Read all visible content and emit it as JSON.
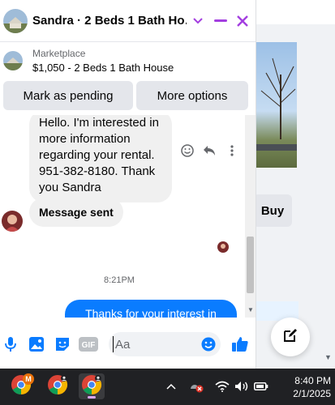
{
  "chat": {
    "title": "Sandra · 2 Beds 1 Bath Ho…",
    "marketplace_label": "Marketplace",
    "listing": "$1,050 - 2 Beds 1 Bath House",
    "mark_pending_label": "Mark as pending",
    "more_options_label": "More options"
  },
  "messages": {
    "incoming_text": "Hello. I'm interested in more information regarding your rental. 951-382-8180. Thank you Sandra",
    "sent_notice": "Message sent",
    "timestamp": "8:21PM",
    "outgoing_text": "Thanks for your interest in"
  },
  "composer": {
    "gif_label": "GIF",
    "placeholder": "Aa"
  },
  "background": {
    "buy_label": "Buy"
  },
  "taskbar": {
    "time": "8:40 PM",
    "date": "2/1/2025",
    "badge_letter": "M"
  },
  "colors": {
    "accent": "#a33ee0",
    "messenger_blue": "#0a7cff",
    "bubble_gray": "#f0f0f0",
    "taskbar": "#202124"
  },
  "icons": [
    "chevron-down-icon",
    "minimize-icon",
    "close-icon",
    "react-icon",
    "reply-icon",
    "more-icon",
    "microphone-icon",
    "photo-icon",
    "sticker-icon",
    "gif-icon",
    "emoji-icon",
    "like-icon",
    "compose-icon",
    "chrome-icon",
    "tray-chevron-icon",
    "wifi-icon",
    "volume-icon",
    "battery-icon"
  ]
}
